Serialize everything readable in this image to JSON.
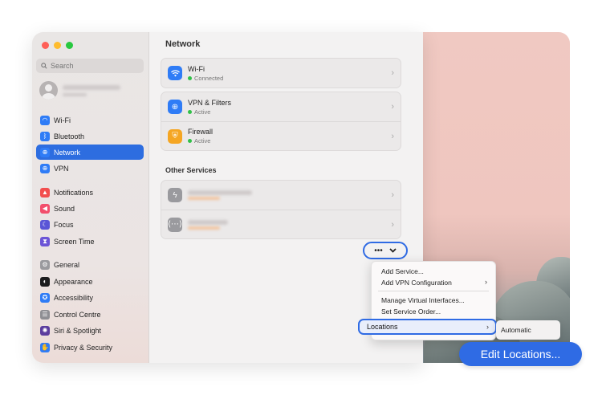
{
  "window": {
    "title": "Network"
  },
  "sidebar": {
    "search_placeholder": "Search",
    "items": [
      {
        "label": "Wi-Fi",
        "icon": "wifi-icon",
        "color": "#2f7cf6",
        "glyph": "◠"
      },
      {
        "label": "Bluetooth",
        "icon": "bluetooth-icon",
        "color": "#2f7cf6",
        "glyph": "ᛒ"
      },
      {
        "label": "Network",
        "icon": "globe-icon",
        "color": "#2f7cf6",
        "glyph": "⊕",
        "active": true
      },
      {
        "label": "VPN",
        "icon": "vpn-globe-icon",
        "color": "#2f7cf6",
        "glyph": "⊕"
      },
      {
        "label": "Notifications",
        "icon": "bell-icon",
        "color": "#f24e4e",
        "glyph": "▲"
      },
      {
        "label": "Sound",
        "icon": "speaker-icon",
        "color": "#f24e6c",
        "glyph": "◀"
      },
      {
        "label": "Focus",
        "icon": "moon-icon",
        "color": "#5a55d6",
        "glyph": "☾"
      },
      {
        "label": "Screen Time",
        "icon": "hourglass-icon",
        "color": "#6c55d6",
        "glyph": "⧗"
      },
      {
        "label": "General",
        "icon": "gear-icon",
        "color": "#9a9a9e",
        "glyph": "⚙"
      },
      {
        "label": "Appearance",
        "icon": "appearance-icon",
        "color": "#1c1c1e",
        "glyph": "◐"
      },
      {
        "label": "Accessibility",
        "icon": "accessibility-icon",
        "color": "#2f7cf6",
        "glyph": "✪"
      },
      {
        "label": "Control Centre",
        "icon": "control-centre-icon",
        "color": "#8e8e93",
        "glyph": "☰"
      },
      {
        "label": "Siri & Spotlight",
        "icon": "siri-icon",
        "color": "#5b3d9e",
        "glyph": "✺"
      },
      {
        "label": "Privacy & Security",
        "icon": "hand-icon",
        "color": "#2f7cf6",
        "glyph": "✋"
      }
    ]
  },
  "main": {
    "services": [
      {
        "name": "Wi-Fi",
        "status": "Connected",
        "icon": "wifi-icon",
        "color": "#2f7cf6"
      },
      {
        "name": "VPN & Filters",
        "status": "Active",
        "icon": "vpn-globe-icon",
        "color": "#2f7cf6"
      },
      {
        "name": "Firewall",
        "status": "Active",
        "icon": "firewall-icon",
        "color": "#f5a623"
      }
    ],
    "other_services_heading": "Other Services",
    "more_button": "•••"
  },
  "menu": {
    "items": [
      "Add Service...",
      "Add VPN Configuration",
      "Manage Virtual Interfaces...",
      "Set Service Order...",
      "Locations"
    ],
    "submenu_item": "Automatic",
    "edit_locations": "Edit Locations..."
  },
  "colors": {
    "accent": "#2f6be4",
    "status_green": "#31c048"
  }
}
